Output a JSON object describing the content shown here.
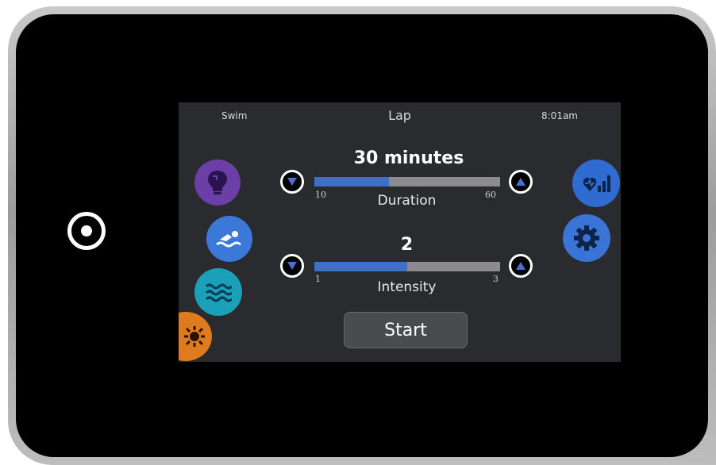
{
  "status_bar": {
    "left": "Swim",
    "title": "Lap",
    "time": "8:01am"
  },
  "duration": {
    "value_text": "30 minutes",
    "label": "Duration",
    "min_label": "10",
    "max_label": "60",
    "min": 10,
    "max": 60,
    "value": 30
  },
  "intensity": {
    "value_text": "2",
    "label": "Intensity",
    "min_label": "1",
    "max_label": "3",
    "min": 1,
    "max": 3,
    "value": 2
  },
  "start_button": {
    "label": "Start"
  },
  "left_menu": [
    {
      "icon": "lightbulb-icon",
      "color": "#6b3fa8"
    },
    {
      "icon": "swimmer-icon",
      "color": "#3b78d8"
    },
    {
      "icon": "waves-icon",
      "color": "#1aa0b8"
    },
    {
      "icon": "sun-icon",
      "color": "#e07a1f"
    }
  ],
  "right_menu": [
    {
      "icon": "heart-bars-icon",
      "color": "#2f6bd0"
    },
    {
      "icon": "gear-icon",
      "color": "#3a74d6"
    }
  ],
  "colors": {
    "slider_fill": "#3f6fc6",
    "slider_track": "#8c8c8c",
    "arrow": "#4a6fd0"
  }
}
